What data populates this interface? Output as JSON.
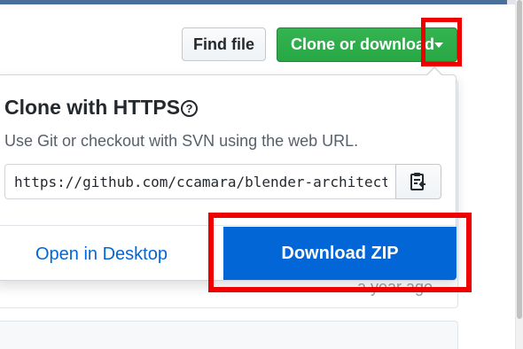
{
  "toolbar": {
    "find_file_label": "Find file",
    "clone_download_label": "Clone or download"
  },
  "clone_panel": {
    "title": "Clone with HTTPS",
    "help_glyph": "?",
    "description": "Use Git or checkout with SVN using the web URL.",
    "url_value": "https://github.com/ccamara/blender-architecture-scripts.git",
    "open_desktop_label": "Open in Desktop",
    "download_zip_label": "Download ZIP"
  },
  "background": {
    "commit_time": "a year ago"
  },
  "icons": {
    "help": "question-circle-icon",
    "copy": "clipboard-icon",
    "caret": "caret-down-icon"
  },
  "colors": {
    "green_button": "#28a745",
    "blue_button": "#0366d6",
    "link_blue": "#0366d6",
    "highlight_red": "#ee0000"
  }
}
